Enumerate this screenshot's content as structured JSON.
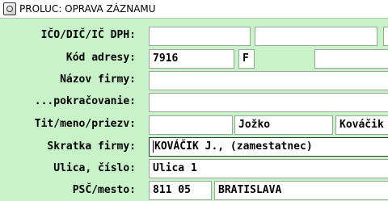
{
  "window": {
    "title": "PROLUC: OPRAVA ZÁZNAMU",
    "icon": "app-icon"
  },
  "form": {
    "ico_label": "IČO/DIČ/IČ DPH:",
    "ico_value": "",
    "dic_value": "",
    "icdph_value": "",
    "kod_label": "Kód adresy:",
    "kod_value": "7916",
    "kod_flag": "F",
    "kod_extra": "",
    "nazov_label": "Názov firmy:",
    "nazov_value": "",
    "pokr_label": "...pokračovanie:",
    "pokr_value": "",
    "tit_label": "Tit/meno/priezv:",
    "tit_value": "",
    "meno_value": "Jožko",
    "priezvisko_value": "Kováčik",
    "skratka_label": "Skratka firmy:",
    "skratka_value": "KOVÁČIK J., (zamestatnec)",
    "ulica_label": "Ulica, číslo:",
    "ulica_value": "Ulica 1",
    "psc_label": "PSČ/mesto:",
    "psc_value": "811 05",
    "mesto_value": "BRATISLAVA"
  }
}
